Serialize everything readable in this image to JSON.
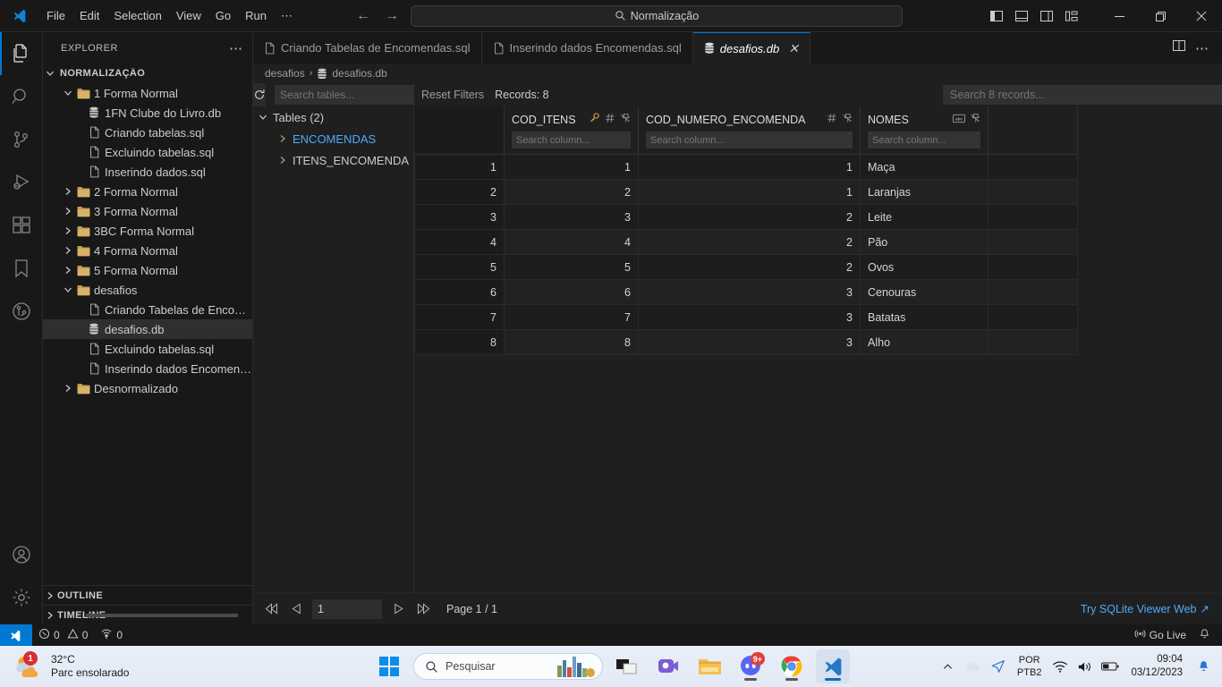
{
  "titlebar": {
    "menu": [
      "File",
      "Edit",
      "Selection",
      "View",
      "Go",
      "Run",
      "⋯"
    ],
    "back_arrow": "←",
    "forward_arrow": "→",
    "command_center_text": "Normalização",
    "search_icon": "search-icon",
    "layout_icons": [
      "toggle-primary-sidebar-icon",
      "toggle-panel-icon",
      "toggle-secondary-sidebar-icon",
      "customize-layout-icon"
    ],
    "window_controls": {
      "minimize": "─",
      "maximize": "❐",
      "close": "✕"
    }
  },
  "activitybar": {
    "items": [
      {
        "name": "explorer",
        "icon": "files-icon",
        "active": true
      },
      {
        "name": "search",
        "icon": "search-icon",
        "active": false
      },
      {
        "name": "source-control",
        "icon": "source-control-icon",
        "active": false
      },
      {
        "name": "run-and-debug",
        "icon": "run-debug-icon",
        "active": false
      },
      {
        "name": "extensions",
        "icon": "extensions-icon",
        "active": false
      },
      {
        "name": "bookmarks",
        "icon": "bookmark-icon",
        "active": false
      },
      {
        "name": "git-graph",
        "icon": "git-graph-icon",
        "active": false
      }
    ],
    "bottom": [
      {
        "name": "accounts",
        "icon": "account-icon"
      },
      {
        "name": "manage-settings",
        "icon": "gear-icon"
      }
    ]
  },
  "sidebar": {
    "title": "EXPLORER",
    "more_actions": "⋯",
    "root": "NORMALIZAÇÃO",
    "tree": [
      {
        "label": "1 Forma Normal",
        "type": "folder",
        "expanded": true,
        "depth": 1
      },
      {
        "label": "1FN Clube do Livro.db",
        "type": "db",
        "depth": 2
      },
      {
        "label": "Criando tabelas.sql",
        "type": "file",
        "depth": 2
      },
      {
        "label": "Excluindo tabelas.sql",
        "type": "file",
        "depth": 2
      },
      {
        "label": "Inserindo dados.sql",
        "type": "file",
        "depth": 2
      },
      {
        "label": "2 Forma Normal",
        "type": "folder",
        "expanded": false,
        "depth": 1
      },
      {
        "label": "3 Forma Normal",
        "type": "folder",
        "expanded": false,
        "depth": 1
      },
      {
        "label": "3BC Forma Normal",
        "type": "folder",
        "expanded": false,
        "depth": 1
      },
      {
        "label": "4 Forma Normal",
        "type": "folder",
        "expanded": false,
        "depth": 1
      },
      {
        "label": "5 Forma Normal",
        "type": "folder",
        "expanded": false,
        "depth": 1
      },
      {
        "label": "desafios",
        "type": "folder",
        "expanded": true,
        "depth": 1
      },
      {
        "label": "Criando Tabelas de Encome...",
        "type": "file",
        "depth": 2
      },
      {
        "label": "desafios.db",
        "type": "db",
        "depth": 2,
        "selected": true
      },
      {
        "label": "Excluindo tabelas.sql",
        "type": "file",
        "depth": 2
      },
      {
        "label": "Inserindo dados Encomend...",
        "type": "file",
        "depth": 2
      },
      {
        "label": "Desnormalizado",
        "type": "folder",
        "expanded": false,
        "depth": 1
      }
    ],
    "sections": [
      "OUTLINE",
      "TIMELINE"
    ]
  },
  "editor": {
    "tabs": [
      {
        "label": "Criando Tabelas de Encomendas.sql",
        "icon": "file-icon",
        "active": false,
        "closable": false
      },
      {
        "label": "Inserindo dados Encomendas.sql",
        "icon": "file-icon",
        "active": false,
        "closable": false
      },
      {
        "label": "desafios.db",
        "icon": "database-icon",
        "active": true,
        "closable": true,
        "close": "✕"
      }
    ],
    "tab_actions": [
      "split-editor-icon",
      "more-actions-icon"
    ],
    "breadcrumb": [
      "desafios",
      "desafios.db"
    ],
    "breadcrumb_separator": "›"
  },
  "sqlite_viewer": {
    "refresh_icon": "refresh-icon",
    "tables_search_placeholder": "Search tables...",
    "tables_header": "Tables (2)",
    "tables": [
      {
        "name": "ENCOMENDAS",
        "highlighted": true
      },
      {
        "name": "ITENS_ENCOMENDA",
        "highlighted": false
      }
    ],
    "reset_filters_label": "Reset Filters",
    "records_label": "Records: 8",
    "global_search_placeholder": "Search 8 records...",
    "column_search_placeholder": "Search column...",
    "columns": [
      {
        "name": "COD_ITENS",
        "icons": [
          "key-icon",
          "number-type-icon",
          "pin-icon"
        ],
        "align": "right"
      },
      {
        "name": "COD_NUMERO_ENCOMENDA",
        "icons": [
          "number-type-icon",
          "pin-icon"
        ],
        "align": "right"
      },
      {
        "name": "NOMES",
        "icons": [
          "text-type-icon",
          "pin-icon"
        ],
        "align": "left"
      }
    ],
    "rows": [
      {
        "n": "1",
        "COD_ITENS": "1",
        "COD_NUMERO_ENCOMENDA": "1",
        "NOMES": "Maça"
      },
      {
        "n": "2",
        "COD_ITENS": "2",
        "COD_NUMERO_ENCOMENDA": "1",
        "NOMES": "Laranjas"
      },
      {
        "n": "3",
        "COD_ITENS": "3",
        "COD_NUMERO_ENCOMENDA": "2",
        "NOMES": "Leite"
      },
      {
        "n": "4",
        "COD_ITENS": "4",
        "COD_NUMERO_ENCOMENDA": "2",
        "NOMES": "Pão"
      },
      {
        "n": "5",
        "COD_ITENS": "5",
        "COD_NUMERO_ENCOMENDA": "2",
        "NOMES": "Ovos"
      },
      {
        "n": "6",
        "COD_ITENS": "6",
        "COD_NUMERO_ENCOMENDA": "3",
        "NOMES": "Cenouras"
      },
      {
        "n": "7",
        "COD_ITENS": "7",
        "COD_NUMERO_ENCOMENDA": "3",
        "NOMES": "Batatas"
      },
      {
        "n": "8",
        "COD_ITENS": "8",
        "COD_NUMERO_ENCOMENDA": "3",
        "NOMES": "Alho"
      }
    ],
    "pagination": {
      "first": "⏪",
      "prev": "◁",
      "next": "▷",
      "last": "⏩",
      "page_value": "1",
      "page_label": "Page 1 / 1"
    },
    "try_web_label": "Try SQLite Viewer Web",
    "try_web_arrow": "↗"
  },
  "statusbar": {
    "remote_icon": "remote-window-icon",
    "errors": "0",
    "warnings": "0",
    "ports": "0",
    "error_icon": "error-icon",
    "warning_icon": "warning-icon",
    "ports_icon": "ports-icon",
    "go_live_label": "Go Live",
    "go_live_icon": "broadcast-icon",
    "bell_icon": "bell-icon"
  },
  "taskbar": {
    "weather_temp": "32°C",
    "weather_desc": "Parc ensolarado",
    "weather_badge": "1",
    "start_icon": "windows-start-icon",
    "search_placeholder": "Pesquisar",
    "search_icon": "search-icon",
    "apps": [
      {
        "name": "task-view",
        "icon": "task-view-icon",
        "active": false,
        "running": false
      },
      {
        "name": "teams",
        "icon": "teams-icon",
        "active": false,
        "running": false
      },
      {
        "name": "file-explorer",
        "icon": "folder-icon",
        "active": false,
        "running": false
      },
      {
        "name": "discord",
        "icon": "discord-icon",
        "active": false,
        "running": true,
        "badge": "9+"
      },
      {
        "name": "chrome",
        "icon": "chrome-icon",
        "active": false,
        "running": true
      },
      {
        "name": "vscode",
        "icon": "vscode-icon",
        "active": true,
        "running": true
      }
    ],
    "tray": {
      "chevron": "ⱏ",
      "onedrive_icon": "cloud-icon",
      "send_icon": "send-icon",
      "lang_line1": "POR",
      "lang_line2": "PTB2",
      "wifi_icon": "wifi-icon",
      "volume_icon": "volume-icon",
      "battery_icon": "battery-icon",
      "time": "09:04",
      "date": "03/12/2023",
      "notification_icon": "bell-icon"
    }
  }
}
